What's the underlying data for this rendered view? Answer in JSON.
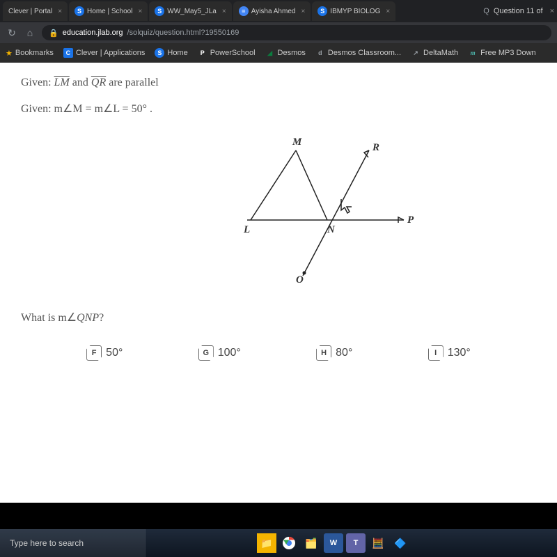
{
  "tabs": [
    {
      "label": "Clever | Portal",
      "icon": ""
    },
    {
      "label": "Home | School",
      "icon": "S"
    },
    {
      "label": "WW_May5_JLa",
      "icon": "S"
    },
    {
      "label": "Ayisha Ahmed",
      "icon": "="
    },
    {
      "label": "IBMYP BIOLOG",
      "icon": "S"
    },
    {
      "label": "Question 11 of",
      "icon": "Q"
    }
  ],
  "url_lock": "🔒",
  "url_host": "education.jlab.org",
  "url_path": "/solquiz/question.html?19550169",
  "bookmarks": [
    {
      "label": "Bookmarks",
      "icon": "★"
    },
    {
      "label": "Clever | Applications",
      "icon": "C"
    },
    {
      "label": "Home",
      "icon": "S"
    },
    {
      "label": "PowerSchool",
      "icon": "P"
    },
    {
      "label": "Desmos",
      "icon": "D"
    },
    {
      "label": "Desmos Classroom...",
      "icon": "d"
    },
    {
      "label": "DeltaMath",
      "icon": "↗"
    },
    {
      "label": "Free MP3 Down",
      "icon": "m"
    }
  ],
  "given1_pre": "Given: ",
  "given1_seg1": "LM",
  "given1_mid": " and ",
  "given1_seg2": "QR",
  "given1_post": " are parallel",
  "given2_pre": "Given: ",
  "given2_eq": "m∠M = m∠L = 50°",
  "given2_post": ".",
  "labels": {
    "M": "M",
    "R": "R",
    "P": "P",
    "N": "N",
    "L": "L",
    "Q": "Q"
  },
  "question": "What is m∠QNP?",
  "answers": [
    {
      "letter": "F",
      "text": "50°"
    },
    {
      "letter": "G",
      "text": "100°"
    },
    {
      "letter": "H",
      "text": "80°"
    },
    {
      "letter": "I",
      "text": "130°"
    }
  ],
  "search_placeholder": "Type here to search"
}
